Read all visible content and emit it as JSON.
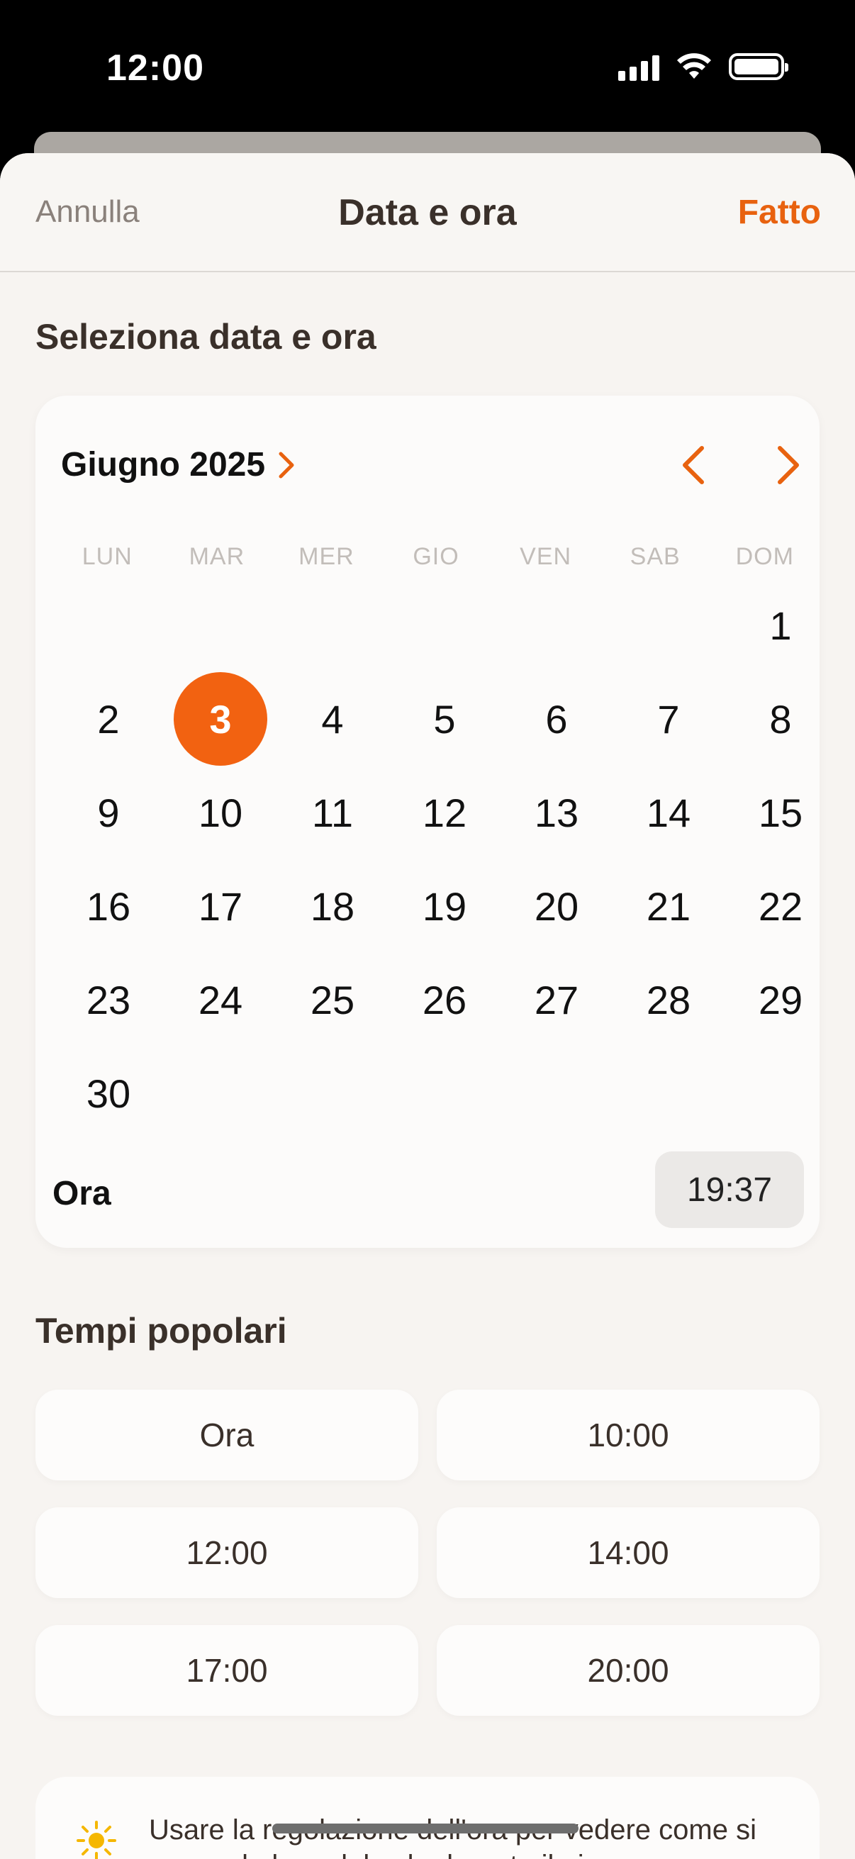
{
  "status_bar": {
    "time": "12:00"
  },
  "nav": {
    "cancel": "Annulla",
    "title": "Data e ora",
    "done": "Fatto"
  },
  "picker": {
    "section_title": "Seleziona data e ora",
    "month_label": "Giugno 2025",
    "weekdays": [
      "LUN",
      "MAR",
      "MER",
      "GIO",
      "VEN",
      "SAB",
      "DOM"
    ],
    "days": [
      "1",
      "2",
      "3",
      "4",
      "5",
      "6",
      "7",
      "8",
      "9",
      "10",
      "11",
      "12",
      "13",
      "14",
      "15",
      "16",
      "17",
      "18",
      "19",
      "20",
      "21",
      "22",
      "23",
      "24",
      "25",
      "26",
      "27",
      "28",
      "29",
      "30"
    ],
    "first_weekday_index": 6,
    "selected_day": "3",
    "time_label": "Ora",
    "time_value": "19:37"
  },
  "popular": {
    "title": "Tempi popolari",
    "options": [
      "Ora",
      "10:00",
      "12:00",
      "14:00",
      "17:00",
      "20:00"
    ]
  },
  "info": {
    "icon": "sun-icon",
    "text": "Usare la regolazione dell'ora per vedere come si muove la luce del sole durante il giorno"
  },
  "colors": {
    "accent": "#f26211",
    "done": "#e8620f"
  }
}
